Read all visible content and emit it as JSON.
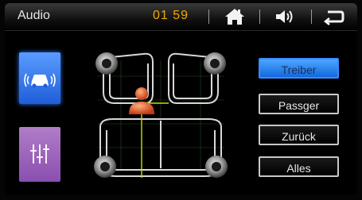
{
  "header": {
    "title": "Audio",
    "clock": "01 59"
  },
  "icons": {
    "home": "home-icon",
    "volume": "volume-icon",
    "back": "back-icon",
    "car_mode": "car-speaker-icon",
    "equalizer": "equalizer-icon",
    "listener": "listener-icon"
  },
  "buttons": {
    "treiber": "Treiber",
    "passger": "Passger",
    "zuruck": "Zurück",
    "alles": "Alles"
  },
  "colors": {
    "accent": "#f0a800",
    "selected_blue": "#2f7bff",
    "eq_purple": "#9a63bd",
    "listener_line": "#c8e000"
  }
}
